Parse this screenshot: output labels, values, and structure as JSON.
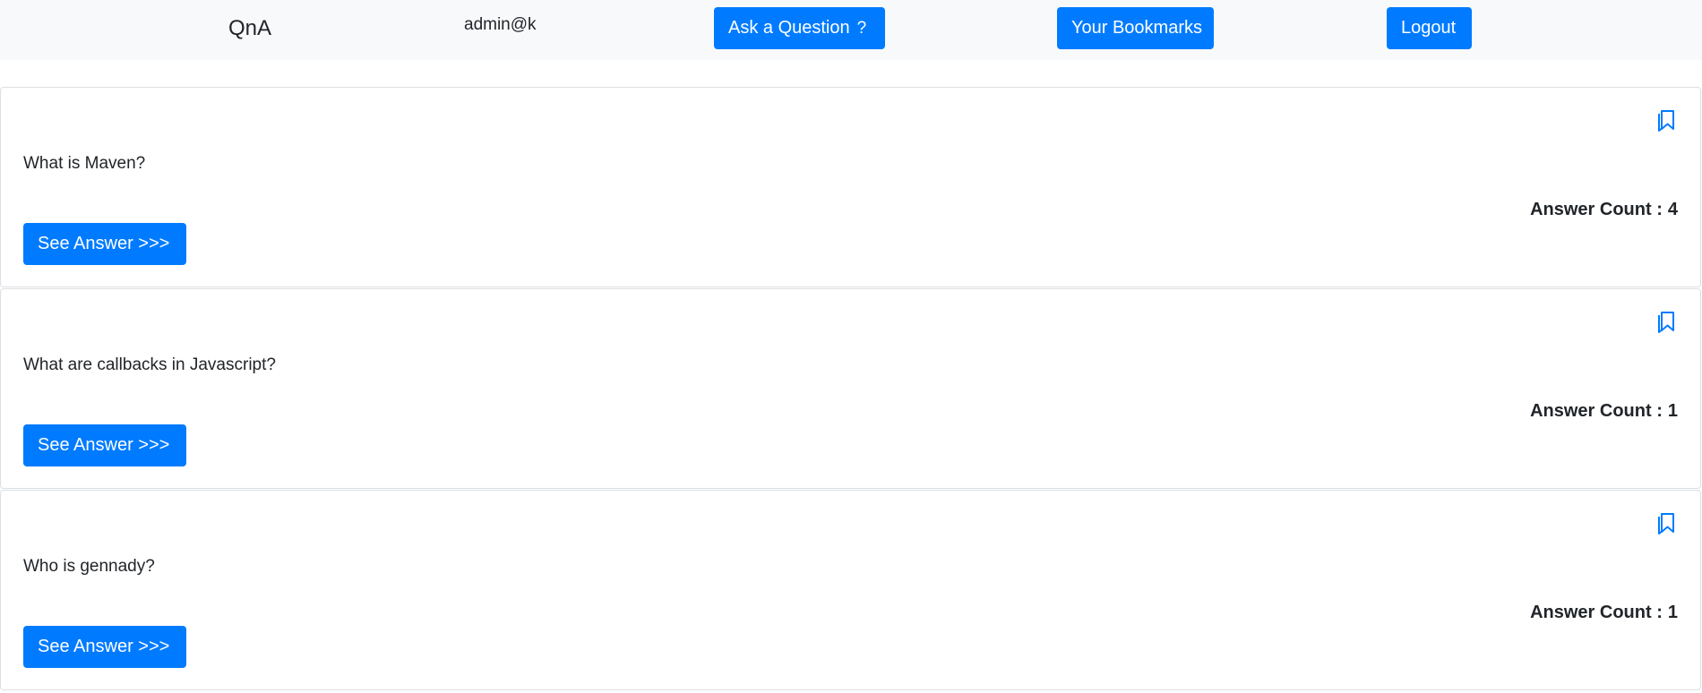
{
  "nav": {
    "brand": "QnA",
    "user": "admin@k",
    "ask_label": "Ask a Question",
    "ask_icon": "?",
    "bookmarks_label": "Your Bookmarks",
    "logout_label": "Logout"
  },
  "colors": {
    "primary": "#007bff",
    "navbar_bg": "#f8f9fa",
    "text": "#212529",
    "card_border": "#dcdfe3"
  },
  "questions": [
    {
      "title": "What is Maven?",
      "answer_count_label": "Answer Count :",
      "answer_count": "4",
      "button_label": "See Answer >>>",
      "bookmark_icon": "bookmark-icon"
    },
    {
      "title": "What are callbacks in Javascript?",
      "answer_count_label": "Answer Count :",
      "answer_count": "1",
      "button_label": "See Answer >>>",
      "bookmark_icon": "bookmark-icon"
    },
    {
      "title": "Who is gennady?",
      "answer_count_label": "Answer Count :",
      "answer_count": "1",
      "button_label": "See Answer >>>",
      "bookmark_icon": "bookmark-icon"
    }
  ]
}
